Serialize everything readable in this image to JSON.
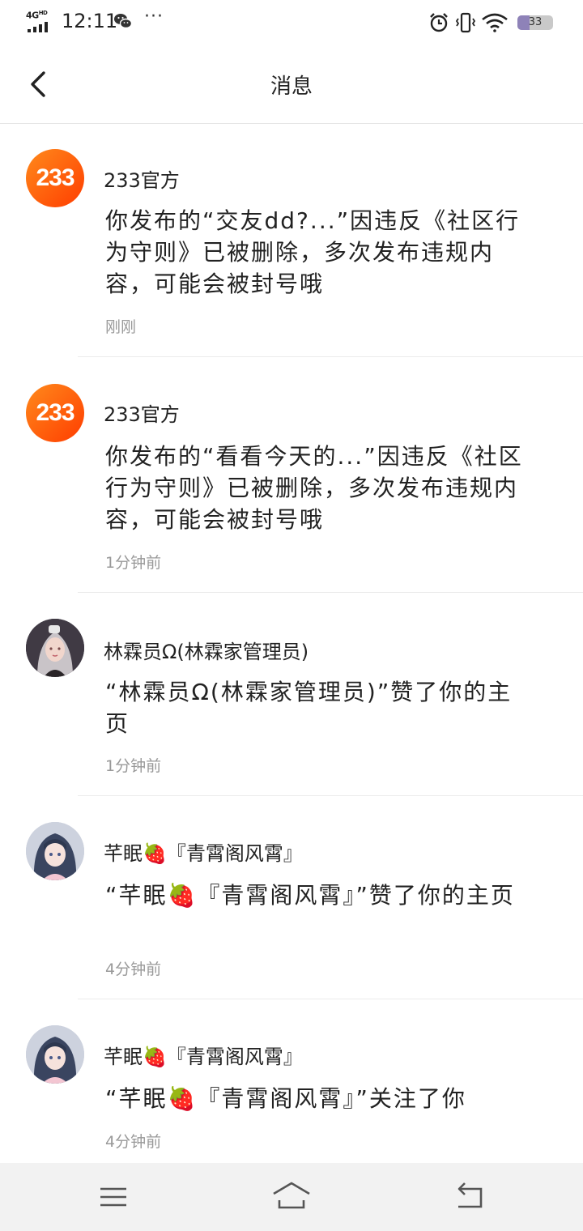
{
  "status_bar": {
    "network": "4G",
    "network_sup": "HD",
    "time": "12:11",
    "more": "···",
    "battery_level": "33",
    "battery_fraction": 0.33
  },
  "header": {
    "title": "消息"
  },
  "messages": [
    {
      "sender": "233官方",
      "avatar_text": "233",
      "text": "你发布的“交友dd?...”因违反《社区行为守则》已被删除，多次发布违规内容，可能会被封号哦",
      "time": "刚刚"
    },
    {
      "sender": "233官方",
      "avatar_text": "233",
      "text": "你发布的“看看今天的...”因违反《社区行为守则》已被删除，多次发布违规内容，可能会被封号哦",
      "time": "1分钟前"
    },
    {
      "sender": "林霖员Ω(林霖家管理员)",
      "text": "“林霖员Ω(林霖家管理员)”赞了你的主页",
      "time": "1分钟前"
    },
    {
      "sender": "芊眠🍓『青霄阁风霄』",
      "text": "“芊眠🍓『青霄阁风霄』”赞了你的主页",
      "time": "4分钟前"
    },
    {
      "sender": "芊眠🍓『青霄阁风霄』",
      "text": "“芊眠🍓『青霄阁风霄』”关注了你",
      "time": "4分钟前"
    }
  ],
  "colors": {
    "brand_orange": "#ff5a0a",
    "secondary_text": "#999999",
    "nav_bg": "#f2f2f2"
  }
}
